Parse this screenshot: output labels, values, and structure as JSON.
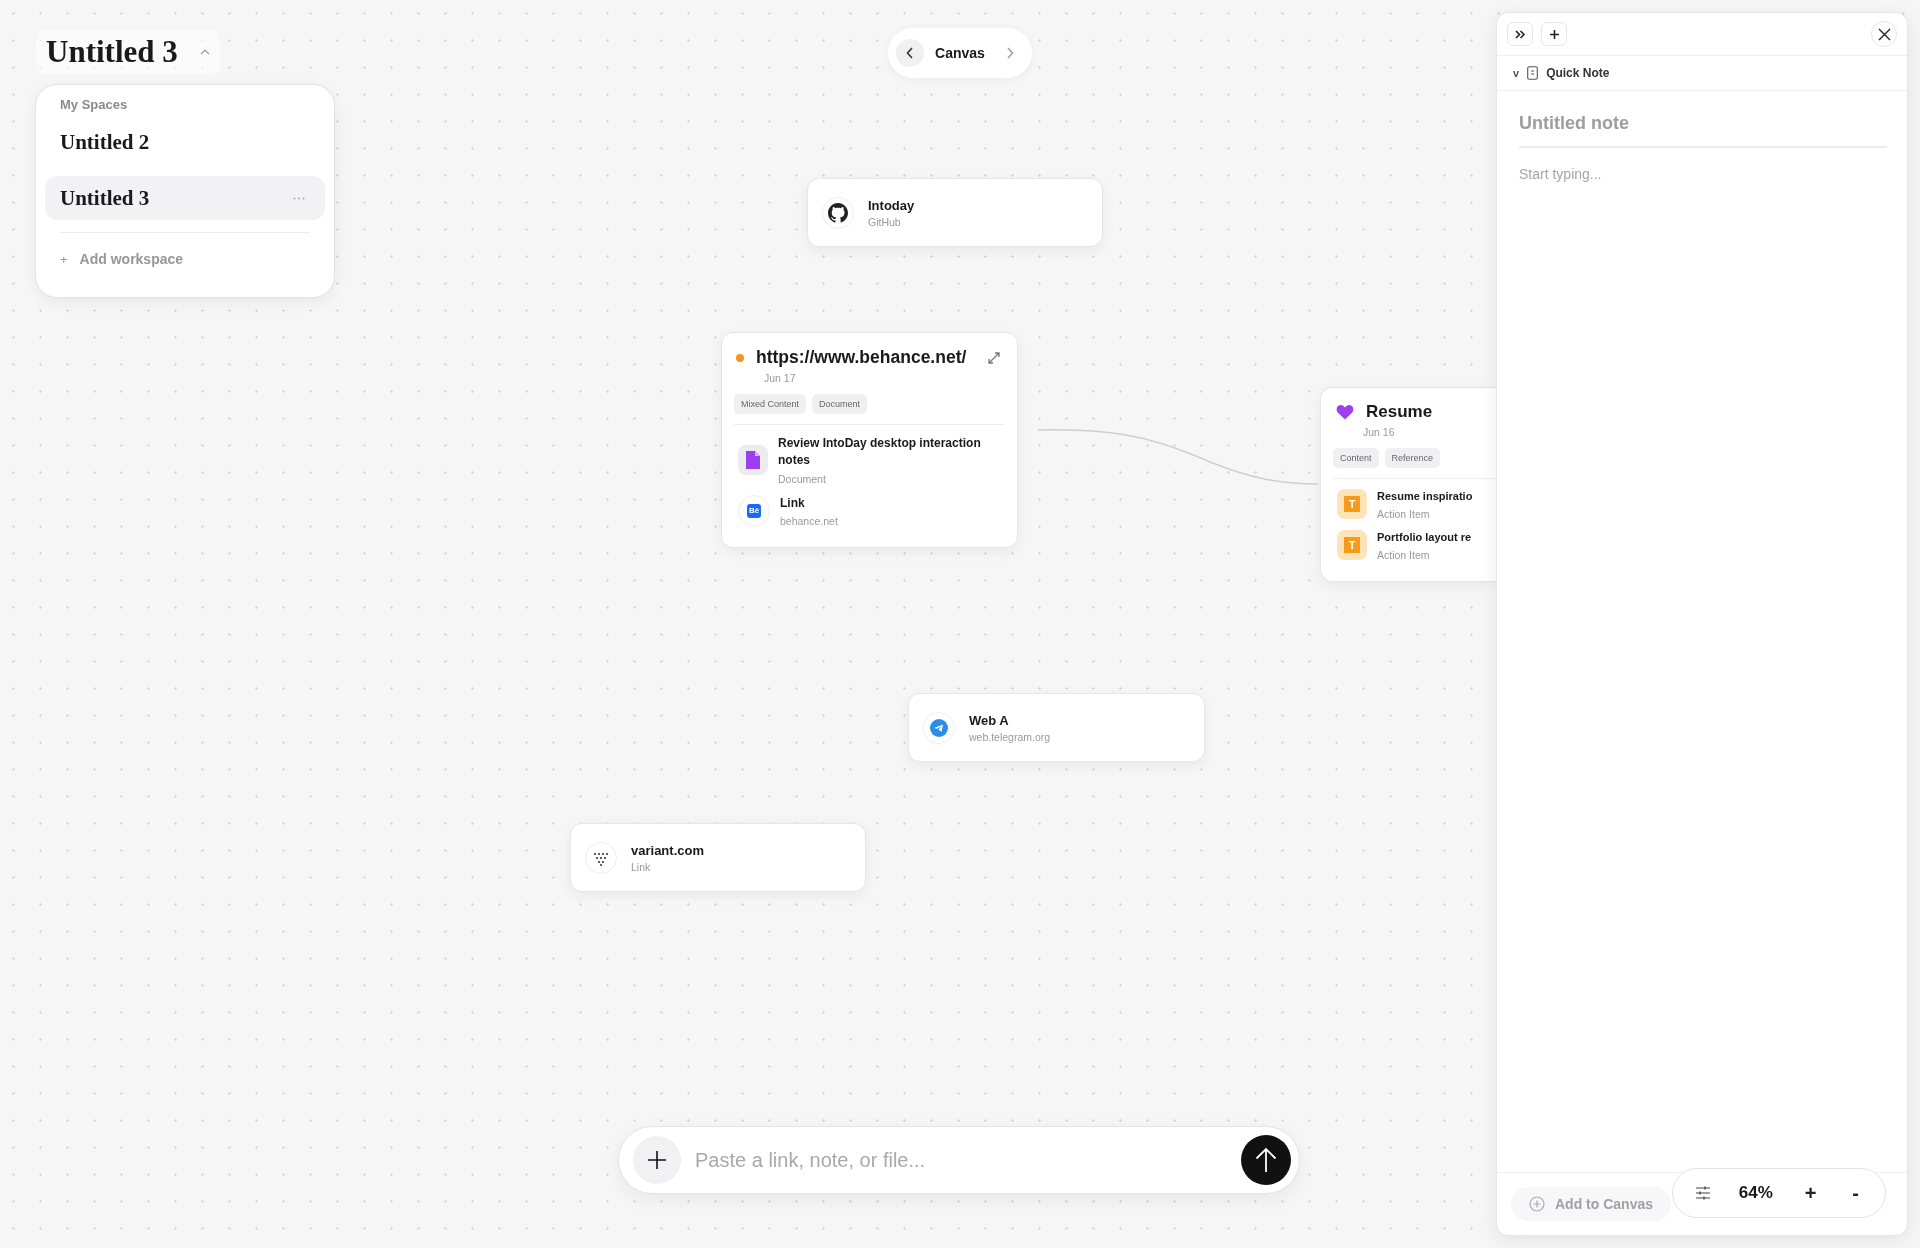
{
  "workspace": {
    "title": "Untitled 3",
    "expanded": true
  },
  "spaces_menu": {
    "heading": "My Spaces",
    "items": [
      {
        "label": "Untitled 2",
        "selected": false
      },
      {
        "label": "Untitled 3",
        "selected": true
      }
    ],
    "add_icon": "+",
    "add_label": "Add workspace"
  },
  "nav": {
    "title": "Canvas"
  },
  "cards": [
    {
      "kind": "link",
      "title": "Intoday",
      "subtitle": "GitHub"
    },
    {
      "kind": "collection",
      "marker": {
        "kind": "dot",
        "color": "#f7931e"
      },
      "title": "https://www.behance.net/",
      "date": "Jun 17",
      "tags": [
        "Mixed Content",
        "Document"
      ],
      "items": [
        {
          "kind": "document",
          "title": "Review IntoDay desktop interaction notes",
          "subtitle": "Document"
        },
        {
          "kind": "link",
          "icon_label": "Bē",
          "title": "Link",
          "subtitle": "behance.net"
        }
      ]
    },
    {
      "kind": "collection",
      "marker": {
        "kind": "heart",
        "color": "#9b3ff0"
      },
      "title": "Resume",
      "date": "Jun 16",
      "tags": [
        "Content",
        "Reference"
      ],
      "items": [
        {
          "kind": "task",
          "icon_label": "T",
          "title": "Resume inspiratio",
          "subtitle": "Action Item"
        },
        {
          "kind": "task",
          "icon_label": "T",
          "title": "Portfolio layout re",
          "subtitle": "Action Item"
        }
      ]
    },
    {
      "kind": "link",
      "title": "Web A",
      "subtitle": "web.telegram.org"
    },
    {
      "kind": "link",
      "title": "variant.com",
      "subtitle": "Link"
    }
  ],
  "composer": {
    "placeholder": "Paste a link, note, or file..."
  },
  "note_panel": {
    "caret": "v",
    "breadcrumb": "Quick Note",
    "title_placeholder": "Untitled note",
    "body_placeholder": "Start typing...",
    "add_button": "Add to Canvas"
  },
  "zoom": {
    "value": "64%",
    "zoom_in": "+",
    "zoom_out": "-"
  }
}
